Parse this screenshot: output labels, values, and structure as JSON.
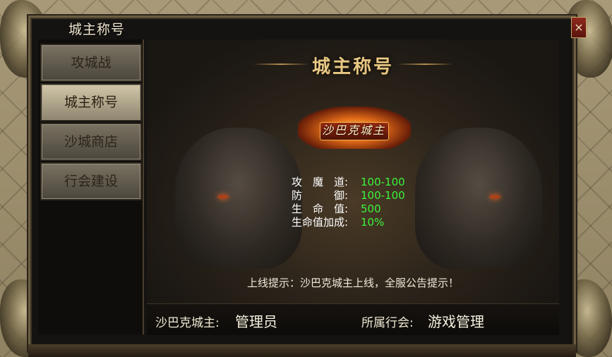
{
  "window": {
    "title": "城主称号",
    "close_label": "×"
  },
  "sidebar": {
    "tabs": [
      {
        "label": "攻城战",
        "active": false
      },
      {
        "label": "城主称号",
        "active": true
      },
      {
        "label": "沙城商店",
        "active": false
      },
      {
        "label": "行会建设",
        "active": false
      }
    ]
  },
  "main": {
    "title": "城主称号",
    "badge_text": "沙巴克城主",
    "stats": [
      {
        "label": "攻　魔　道:",
        "value": "100-100"
      },
      {
        "label": "防　　　御:",
        "value": "100-100"
      },
      {
        "label": "生　命　值:",
        "value": "500"
      },
      {
        "label": "生命值加成:",
        "value": "10%"
      }
    ],
    "hint": "上线提示：沙巴克城主上线，全服公告提示！"
  },
  "info": {
    "owner_label": "沙巴克城主:",
    "owner_value": "管理员",
    "guild_label": "所属行会:",
    "guild_value": "游戏管理"
  },
  "colors": {
    "stat_value": "#3cf43c",
    "title_gold": "#e8c884"
  }
}
